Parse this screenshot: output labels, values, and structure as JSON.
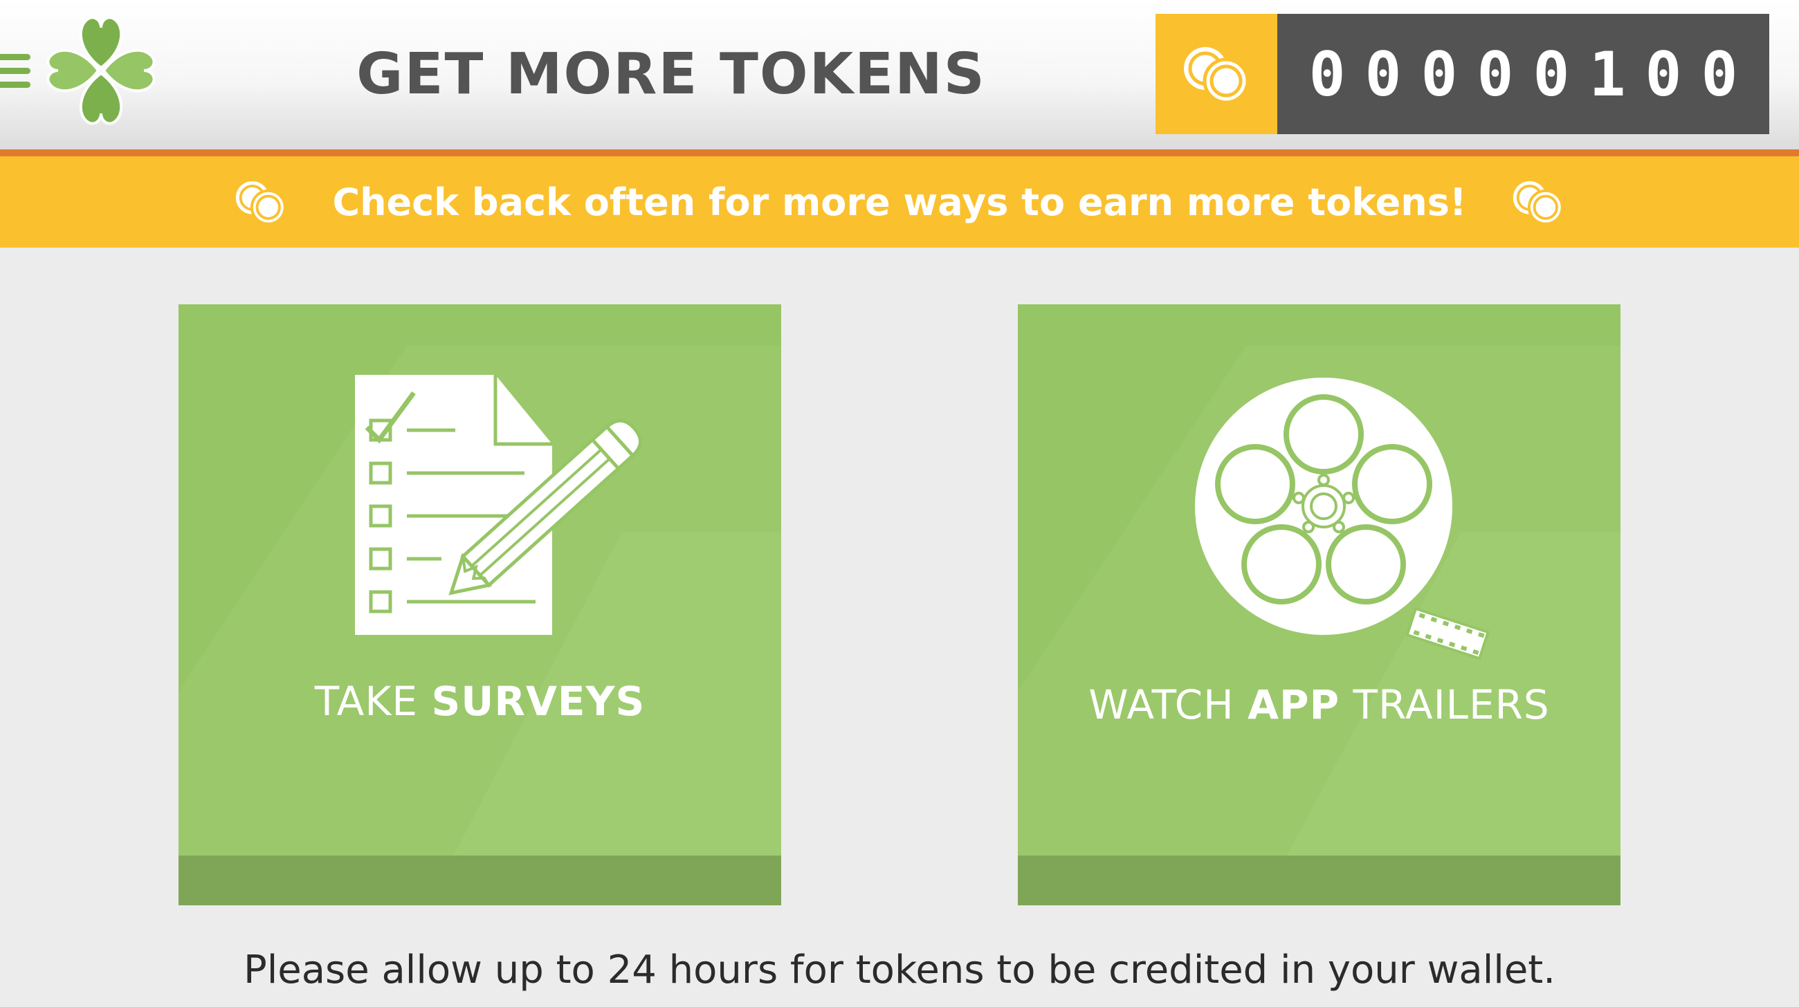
{
  "header": {
    "title": "GET MORE TOKENS",
    "menu_icon": "hamburger-menu-icon",
    "logo_icon": "clover-logo",
    "token_icon": "coins-icon",
    "token_count": "00000100"
  },
  "banner": {
    "text": "Check back often for more ways to earn more tokens!",
    "icon": "coins-icon"
  },
  "cards": [
    {
      "icon": "survey-checklist-pencil-icon",
      "label_light": "TAKE ",
      "label_bold": "SURVEYS"
    },
    {
      "icon": "film-reel-icon",
      "label_light": "WATCH ",
      "label_bold": "APP",
      "label_tail": " TRAILERS"
    }
  ],
  "footer": {
    "note": "Please allow up to 24 hours for tokens to be credited in your wallet."
  },
  "colors": {
    "accent_yellow": "#fbc02d",
    "accent_orange": "#e07b2e",
    "card_green": "#96c566",
    "card_green_dark": "#7fa657",
    "counter_bg": "#535353",
    "title_gray": "#545454"
  }
}
